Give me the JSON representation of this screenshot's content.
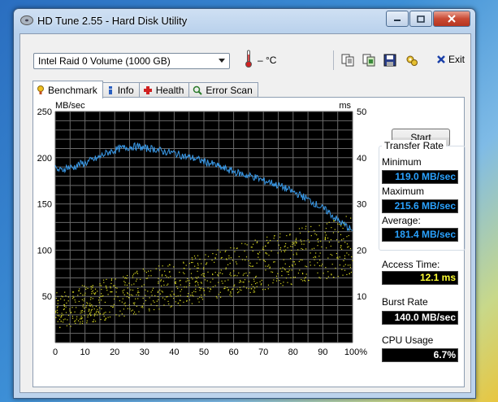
{
  "window": {
    "title": "HD Tune 2.55 - Hard Disk Utility"
  },
  "toolbar": {
    "drive": "Intel   Raid 0 Volume (1000 GB)",
    "temperature": "– °C",
    "exit_label": "Exit",
    "buttons": [
      "copy-text-icon",
      "copy-screenshot-icon",
      "save-icon",
      "options-icon"
    ]
  },
  "tabs": [
    {
      "label": "Benchmark",
      "icon": "benchmark-icon"
    },
    {
      "label": "Info",
      "icon": "info-icon"
    },
    {
      "label": "Health",
      "icon": "health-icon"
    },
    {
      "label": "Error Scan",
      "icon": "scan-icon"
    }
  ],
  "side": {
    "start_label": "Start",
    "transfer_rate_title": "Transfer Rate",
    "minimum_label": "Minimum",
    "minimum_value": "119.0 MB/sec",
    "maximum_label": "Maximum",
    "maximum_value": "215.6 MB/sec",
    "average_label": "Average:",
    "average_value": "181.4 MB/sec",
    "access_label": "Access Time:",
    "access_value": "12.1 ms",
    "burst_label": "Burst Rate",
    "burst_value": "140.0 MB/sec",
    "cpu_label": "CPU Usage",
    "cpu_value": "6.7%"
  },
  "colors": {
    "transfer": "#3a9ae8",
    "access": "#d8d820",
    "grid": "#6a6a6a",
    "bg": "#000000"
  },
  "chart_data": {
    "type": "line",
    "ylabel": "MB/sec",
    "y2label": "ms",
    "xlim": [
      0,
      100
    ],
    "ylim": [
      0,
      250
    ],
    "y2lim": [
      0,
      50
    ],
    "x_ticks": [
      "0",
      "10",
      "20",
      "30",
      "40",
      "50",
      "60",
      "70",
      "80",
      "90",
      "100%"
    ],
    "y_ticks": [
      "50",
      "100",
      "150",
      "200",
      "250"
    ],
    "y2_ticks": [
      "10",
      "20",
      "30",
      "40",
      "50"
    ],
    "grid": true,
    "series": [
      {
        "x": [
          0,
          2,
          4,
          6,
          8,
          10,
          12,
          14,
          16,
          18,
          20,
          22,
          24,
          26,
          28,
          30,
          32,
          34,
          36,
          38,
          40,
          42,
          44,
          46,
          48,
          50,
          52,
          54,
          56,
          58,
          60,
          62,
          64,
          66,
          68,
          70,
          72,
          74,
          76,
          78,
          80,
          82,
          84,
          86,
          88,
          90,
          92,
          94,
          96,
          98,
          100
        ],
        "values": [
          188,
          186,
          190,
          189,
          193,
          194,
          197,
          199,
          203,
          206,
          208,
          210,
          211,
          212,
          212,
          210,
          210,
          209,
          207,
          206,
          205,
          203,
          201,
          200,
          198,
          196,
          194,
          192,
          189,
          187,
          185,
          183,
          181,
          180,
          178,
          175,
          174,
          171,
          169,
          166,
          163,
          160,
          157,
          153,
          149,
          145,
          141,
          135,
          130,
          126,
          121
        ]
      }
    ],
    "access_time_scatter": {
      "unit": "ms",
      "range_ms": [
        2,
        22
      ],
      "trend": "increasing with position",
      "average_ms": 12.1
    }
  }
}
